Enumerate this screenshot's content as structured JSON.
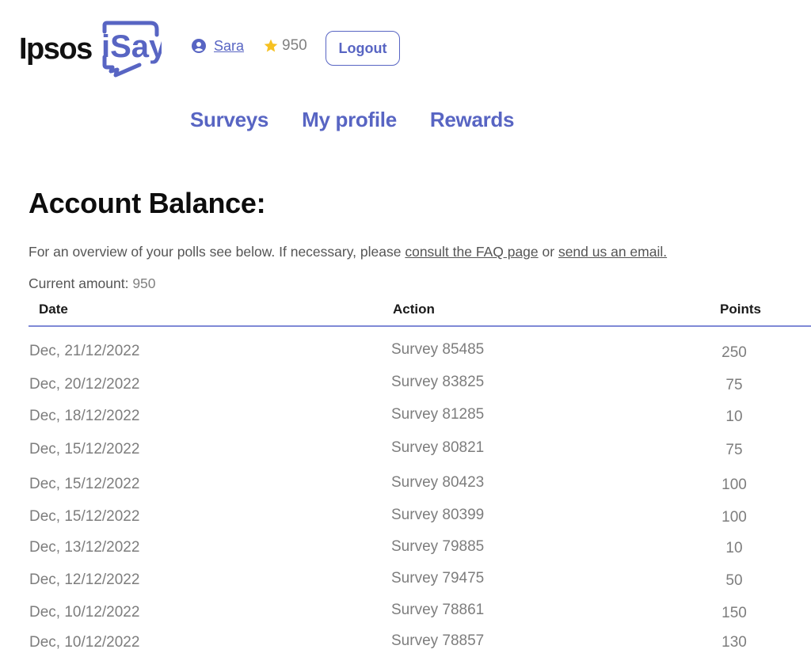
{
  "header": {
    "logo_text": "Ipsos",
    "logo_brand": "iSay",
    "user_name": "Sara",
    "points_balance": "950",
    "logout_label": "Logout",
    "icons": {
      "user": "user-circle-icon",
      "star": "star-icon"
    },
    "colors": {
      "brand": "#5865c3",
      "star": "#f6c122"
    }
  },
  "nav": {
    "items": [
      {
        "label": "Surveys"
      },
      {
        "label": "My profile"
      },
      {
        "label": "Rewards"
      }
    ]
  },
  "main": {
    "title": "Account Balance:",
    "intro_text": "For an overview of your polls see below. If necessary, please ",
    "faq_link": "consult the FAQ page",
    "intro_or": " or ",
    "email_link": "send us an email.",
    "current_label": "Current amount: ",
    "current_value": "950"
  },
  "table": {
    "columns": [
      "Date",
      "Action",
      "Points"
    ],
    "rows": [
      {
        "date": "Dec, 21/12/2022",
        "action": "Survey 85485",
        "points": "250"
      },
      {
        "date": "Dec, 20/12/2022",
        "action": "Survey 83825",
        "points": "75"
      },
      {
        "date": "Dec, 18/12/2022",
        "action": "Survey 81285",
        "points": "10"
      },
      {
        "date": "Dec, 15/12/2022",
        "action": "Survey 80821",
        "points": "75"
      },
      {
        "date": "Dec, 15/12/2022",
        "action": "Survey 80423",
        "points": "100"
      },
      {
        "date": "Dec, 15/12/2022",
        "action": "Survey 80399",
        "points": "100"
      },
      {
        "date": "Dec, 13/12/2022",
        "action": "Survey 79885",
        "points": "10"
      },
      {
        "date": "Dec, 12/12/2022",
        "action": "Survey 79475",
        "points": "50"
      },
      {
        "date": "Dec, 10/12/2022",
        "action": "Survey 78861",
        "points": "150"
      },
      {
        "date": "Dec, 10/12/2022",
        "action": "Survey 78857",
        "points": "130"
      }
    ]
  }
}
